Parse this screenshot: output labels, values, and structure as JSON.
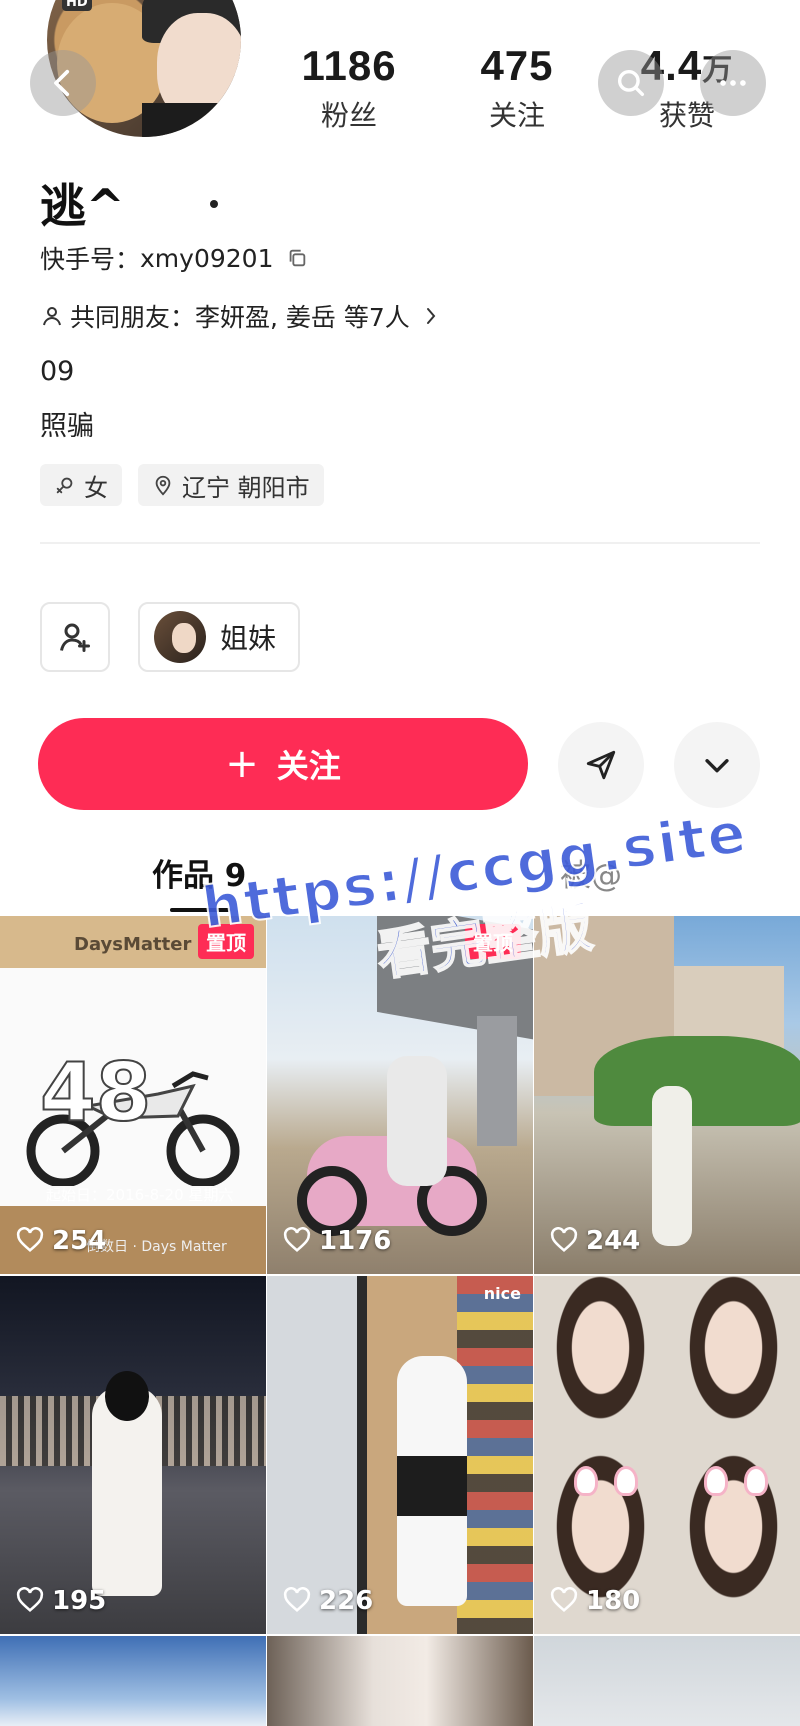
{
  "header": {
    "hd_badge": "HD",
    "stats": {
      "fans": {
        "value": "1186",
        "label": "粉丝"
      },
      "following": {
        "value": "475",
        "label": "关注"
      },
      "likes": {
        "value": "4.4",
        "unit": "万",
        "label": "获赞"
      }
    }
  },
  "profile": {
    "username": "逃^",
    "ks_id_label": "快手号：",
    "ks_id": "xmy09201",
    "mutual_friends": "共同朋友：李妍盈, 姜岳 等7人",
    "bio_line1": "09",
    "bio_line2": "照骗",
    "gender": "女",
    "location": "辽宁 朝阳市"
  },
  "actions": {
    "group_chip_label": "姐妹",
    "follow_label": "关注",
    "follow_plus": "+"
  },
  "tabs": [
    {
      "label": "作品 9",
      "active": true
    },
    {
      "label": "被@",
      "active": false
    }
  ],
  "grid": {
    "pin_label": "置顶",
    "items": [
      {
        "likes": "254",
        "pinned": true,
        "brand": "DaysMatter",
        "count": "48",
        "footer": "起始日：2016-8-20 星期六",
        "footer2": "倒数日 · Days Matter"
      },
      {
        "likes": "1176",
        "pinned": true
      },
      {
        "likes": "244",
        "pinned": false
      },
      {
        "likes": "195",
        "pinned": false
      },
      {
        "likes": "226",
        "pinned": false,
        "overlay": "nice"
      },
      {
        "likes": "180",
        "pinned": false
      },
      {
        "likes": ""
      },
      {
        "likes": ""
      },
      {
        "likes": ""
      }
    ]
  },
  "watermark": {
    "line1": "https://ccgg.site",
    "line2": "看完整版"
  },
  "colors": {
    "accent": "#fe2c55",
    "watermark": "#3d5bd8"
  },
  "icons": {
    "back": "back-arrow-icon",
    "search": "search-icon",
    "more": "more-dots-icon",
    "copy": "copy-icon",
    "person": "person-icon",
    "gender": "female-icon",
    "location": "location-pin-icon",
    "add_friend": "add-friend-icon",
    "send": "send-icon",
    "dropdown": "chevron-down-icon",
    "heart": "heart-icon"
  }
}
